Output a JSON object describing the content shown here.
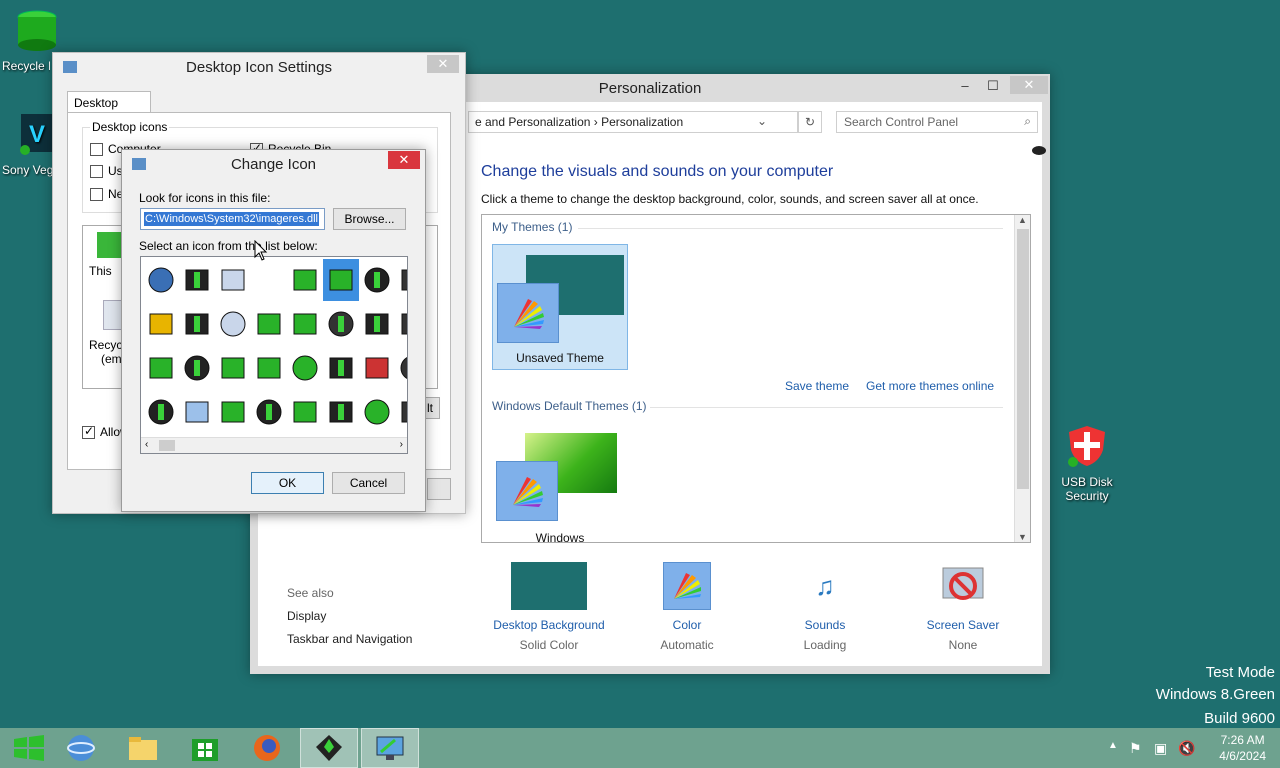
{
  "desktop": {
    "icons": [
      {
        "label": "Recycle Bin",
        "icon": "recycle-bin-icon"
      },
      {
        "label": "Sony Vegas",
        "icon": "sony-vegas-icon"
      },
      {
        "label": "USB Disk Security",
        "icon": "usb-disk-security-icon"
      }
    ],
    "watermark": [
      "Test Mode",
      "Windows 8.Green",
      "Build 9600"
    ]
  },
  "personalization": {
    "title": "Personalization",
    "address": "e and Personalization  ›  Personalization",
    "search_placeholder": "Search Control Panel",
    "heading": "Change the visuals and sounds on your computer",
    "subheading": "Click a theme to change the desktop background, color, sounds, and screen saver all at once.",
    "my_themes_label": "My Themes (1)",
    "unsaved_theme": "Unsaved Theme",
    "save_theme": "Save theme",
    "get_more": "Get more themes online",
    "default_themes_label": "Windows Default Themes (1)",
    "windows_theme": "Windows",
    "see_also": "See also",
    "display": "Display",
    "taskbar_nav": "Taskbar and Navigation",
    "bottom": [
      {
        "label": "Desktop Background",
        "sub": "Solid Color"
      },
      {
        "label": "Color",
        "sub": "Automatic"
      },
      {
        "label": "Sounds",
        "sub": "Loading"
      },
      {
        "label": "Screen Saver",
        "sub": "None"
      }
    ],
    "background_color": "#1e6f6f"
  },
  "desktop_icon_settings": {
    "title": "Desktop Icon Settings",
    "tab": "Desktop Icons",
    "group": "Desktop icons",
    "checks": [
      {
        "label": "Computer",
        "checked": false
      },
      {
        "label": "Us",
        "checked": false
      },
      {
        "label": "Ne",
        "checked": false
      },
      {
        "label": "Recycle Bin",
        "checked": true
      }
    ],
    "this_pc": "This",
    "recycle": "Recyc",
    "recycle_sub": "(emp",
    "allow": "Allow",
    "partial_btn": "lt"
  },
  "change_icon": {
    "title": "Change Icon",
    "look_label": "Look for icons in this file:",
    "file_path": "C:\\Windows\\System32\\imageres.dll",
    "browse": "Browse...",
    "select_label": "Select an icon from the list below:",
    "ok": "OK",
    "cancel": "Cancel"
  },
  "taskbar": {
    "time": "7:26 AM",
    "date": "4/6/2024",
    "buttons": [
      "start-icon",
      "internet-explorer-icon",
      "file-explorer-icon",
      "store-icon",
      "firefox-icon",
      "app-icon",
      "personalization-icon"
    ]
  },
  "colors": {
    "accent": "#3d8fe0",
    "link": "#1f5eab",
    "taskbar": "#6ea28f",
    "close": "#d9363e"
  }
}
